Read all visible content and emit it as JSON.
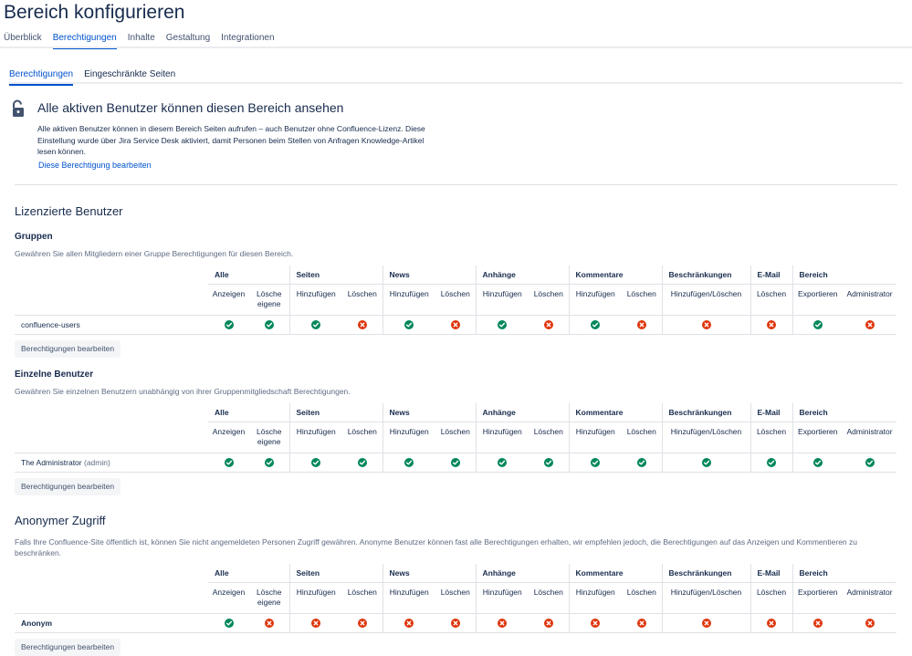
{
  "page": {
    "title": "Bereich konfigurieren"
  },
  "top_tabs": [
    {
      "label": "Überblick",
      "active": false
    },
    {
      "label": "Berechtigungen",
      "active": true
    },
    {
      "label": "Inhalte",
      "active": false
    },
    {
      "label": "Gestaltung",
      "active": false
    },
    {
      "label": "Integrationen",
      "active": false
    }
  ],
  "sub_tabs": [
    {
      "label": "Berechtigungen",
      "active": true
    },
    {
      "label": "Eingeschränkte Seiten",
      "active": false
    }
  ],
  "info": {
    "icon": "unlock-icon",
    "heading": "Alle aktiven Benutzer können diesen Bereich ansehen",
    "text": "Alle aktiven Benutzer können in diesem Bereich Seiten aufrufen – auch Benutzer ohne Confluence-Lizenz. Diese Einstellung wurde über Jira Service Desk aktiviert, damit Personen beim Stellen von Anfragen Knowledge-Artikel lesen können.",
    "link": "Diese Berechtigung bearbeiten"
  },
  "licensed": {
    "heading": "Lizenzierte Benutzer"
  },
  "columns": {
    "groups": [
      "Alle",
      "Seiten",
      "News",
      "Anhänge",
      "Kommentare",
      "Beschränkungen",
      "E-Mail",
      "Bereich"
    ],
    "subs": [
      "Anzeigen",
      "Lösche eigene",
      "Hinzufügen",
      "Löschen",
      "Hinzufügen",
      "Löschen",
      "Hinzufügen",
      "Löschen",
      "Hinzufügen",
      "Löschen",
      "Hinzufügen/Löschen",
      "Löschen",
      "Exportieren",
      "Administrator"
    ]
  },
  "groups_section": {
    "heading": "Gruppen",
    "description": "Gewähren Sie allen Mitgliedern einer Gruppe Berechtigungen für diesen Bereich.",
    "rows": [
      {
        "name": "confluence-users",
        "perms": [
          true,
          true,
          true,
          false,
          true,
          false,
          true,
          false,
          true,
          false,
          false,
          false,
          true,
          false
        ]
      }
    ],
    "button": "Berechtigungen bearbeiten"
  },
  "users_section": {
    "heading": "Einzelne Benutzer",
    "description": "Gewähren Sie einzelnen Benutzern unabhängig von ihrer Gruppenmitgliedschaft Berechtigungen.",
    "rows": [
      {
        "name": "The Administrator",
        "username": "(admin)",
        "perms": [
          true,
          true,
          true,
          true,
          true,
          true,
          true,
          true,
          true,
          true,
          true,
          true,
          true,
          true
        ]
      }
    ],
    "button": "Berechtigungen bearbeiten"
  },
  "anonymous_section": {
    "heading": "Anonymer Zugriff",
    "description": "Falls Ihre Confluence-Site öffentlich ist, können Sie nicht angemeldeten Personen Zugriff gewähren. Anonyme Benutzer können fast alle Berechtigungen erhalten, wir empfehlen jedoch, die Berechtigungen auf das Anzeigen und Kommentieren zu beschränken.",
    "rows": [
      {
        "name": "Anonym",
        "perms": [
          true,
          false,
          false,
          false,
          false,
          false,
          false,
          false,
          false,
          false,
          false,
          false,
          false,
          false
        ]
      }
    ],
    "button": "Berechtigungen bearbeiten"
  },
  "colors": {
    "accent": "#0052cc",
    "granted": "#00875a",
    "denied": "#de350b"
  }
}
